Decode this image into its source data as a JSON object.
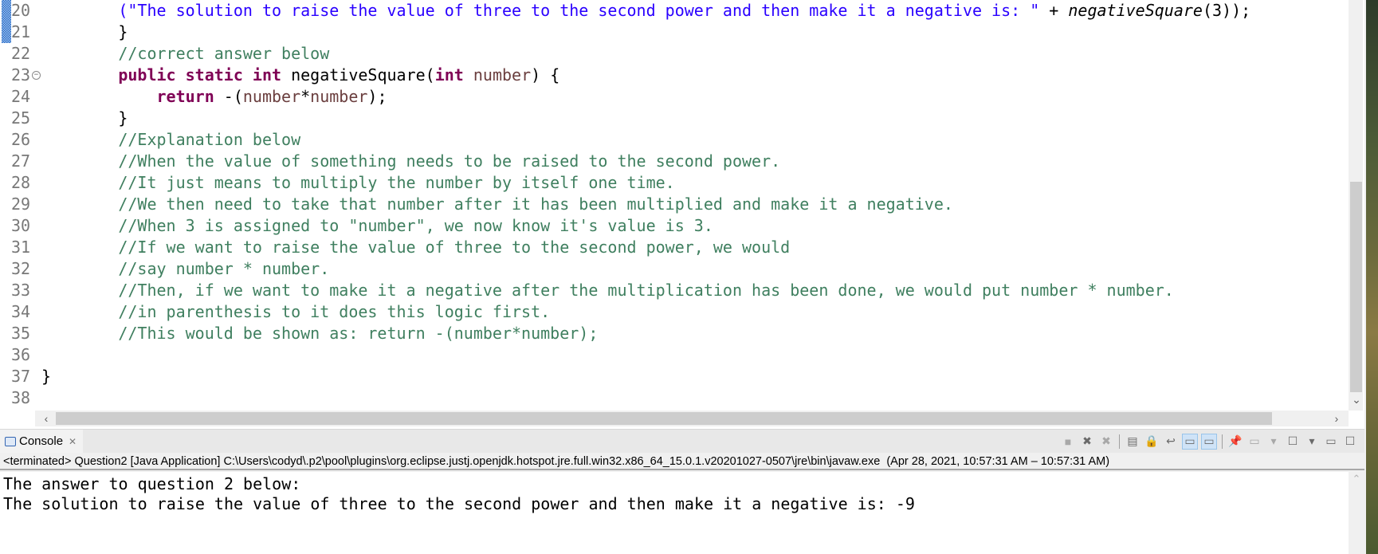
{
  "editor": {
    "lines": [
      {
        "num": "20",
        "segments": [
          {
            "cls": "pl",
            "text": "        "
          },
          {
            "cls": "str",
            "text": "(\"The solution to raise the value of three to the second power and then make it a negative is: \""
          },
          {
            "cls": "pl",
            "text": " + "
          },
          {
            "cls": "it",
            "text": "negativeSquare"
          },
          {
            "cls": "pl",
            "text": "(3));"
          }
        ]
      },
      {
        "num": "21",
        "segments": [
          {
            "cls": "pl",
            "text": "        }"
          }
        ]
      },
      {
        "num": "22",
        "segments": [
          {
            "cls": "pl",
            "text": "        "
          },
          {
            "cls": "cm",
            "text": "//correct answer below"
          }
        ]
      },
      {
        "num": "23",
        "fold": true,
        "segments": [
          {
            "cls": "pl",
            "text": "        "
          },
          {
            "cls": "kw",
            "text": "public static int"
          },
          {
            "cls": "pl",
            "text": " negativeSquare("
          },
          {
            "cls": "kw",
            "text": "int"
          },
          {
            "cls": "pl",
            "text": " "
          },
          {
            "cls": "var",
            "text": "number"
          },
          {
            "cls": "pl",
            "text": ") {"
          }
        ]
      },
      {
        "num": "24",
        "segments": [
          {
            "cls": "pl",
            "text": "            "
          },
          {
            "cls": "kw",
            "text": "return"
          },
          {
            "cls": "pl",
            "text": " -("
          },
          {
            "cls": "var",
            "text": "number"
          },
          {
            "cls": "pl",
            "text": "*"
          },
          {
            "cls": "var",
            "text": "number"
          },
          {
            "cls": "pl",
            "text": ");"
          }
        ]
      },
      {
        "num": "25",
        "segments": [
          {
            "cls": "pl",
            "text": "        }"
          }
        ]
      },
      {
        "num": "26",
        "segments": [
          {
            "cls": "pl",
            "text": "        "
          },
          {
            "cls": "cm",
            "text": "//Explanation below"
          }
        ]
      },
      {
        "num": "27",
        "segments": [
          {
            "cls": "pl",
            "text": "        "
          },
          {
            "cls": "cm",
            "text": "//When the value of something needs to be raised to the second power."
          }
        ]
      },
      {
        "num": "28",
        "segments": [
          {
            "cls": "pl",
            "text": "        "
          },
          {
            "cls": "cm",
            "text": "//It just means to multiply the number by itself one time."
          }
        ]
      },
      {
        "num": "29",
        "segments": [
          {
            "cls": "pl",
            "text": "        "
          },
          {
            "cls": "cm",
            "text": "//We then need to take that number after it has been multiplied and make it a negative."
          }
        ]
      },
      {
        "num": "30",
        "segments": [
          {
            "cls": "pl",
            "text": "        "
          },
          {
            "cls": "cm",
            "text": "//When 3 is assigned to \"number\", we now know it's value is 3."
          }
        ]
      },
      {
        "num": "31",
        "segments": [
          {
            "cls": "pl",
            "text": "        "
          },
          {
            "cls": "cm",
            "text": "//If we want to raise the value of three to the second power, we would"
          }
        ]
      },
      {
        "num": "32",
        "segments": [
          {
            "cls": "pl",
            "text": "        "
          },
          {
            "cls": "cm",
            "text": "//say number * number."
          }
        ]
      },
      {
        "num": "33",
        "segments": [
          {
            "cls": "pl",
            "text": "        "
          },
          {
            "cls": "cm",
            "text": "//Then, if we want to make it a negative after the multiplication has been done, we would put number * number."
          }
        ]
      },
      {
        "num": "34",
        "segments": [
          {
            "cls": "pl",
            "text": "        "
          },
          {
            "cls": "cm",
            "text": "//in parenthesis to it does this logic first."
          }
        ]
      },
      {
        "num": "35",
        "segments": [
          {
            "cls": "pl",
            "text": "        "
          },
          {
            "cls": "cm",
            "text": "//This would be shown as: return -(number*number);"
          }
        ]
      },
      {
        "num": "36",
        "segments": []
      },
      {
        "num": "37",
        "segments": [
          {
            "cls": "pl",
            "text": "}"
          }
        ]
      },
      {
        "num": "38",
        "segments": []
      }
    ],
    "scroll_icons": {
      "down": "chevron-down",
      "left": "chevron-left",
      "right": "chevron-right"
    }
  },
  "console": {
    "tab_label": "Console",
    "tab_icon": "console-icon",
    "tab_close_icon": "close-icon",
    "toolbar": [
      {
        "name": "terminate-icon",
        "glyph": "■",
        "state": "disabled"
      },
      {
        "name": "remove-launch-icon",
        "glyph": "✖",
        "state": "normal"
      },
      {
        "name": "remove-all-terminated-icon",
        "glyph": "✖",
        "state": "disabled"
      },
      {
        "name": "sep"
      },
      {
        "name": "clear-console-icon",
        "glyph": "▤",
        "state": "normal"
      },
      {
        "name": "scroll-lock-icon",
        "glyph": "🔒",
        "state": "normal"
      },
      {
        "name": "word-wrap-icon",
        "glyph": "↩",
        "state": "normal"
      },
      {
        "name": "show-on-stdout-icon",
        "glyph": "▭",
        "state": "active"
      },
      {
        "name": "show-on-stderr-icon",
        "glyph": "▭",
        "state": "active"
      },
      {
        "name": "sep"
      },
      {
        "name": "pin-console-icon",
        "glyph": "📌",
        "state": "normal"
      },
      {
        "name": "display-selected-console-icon",
        "glyph": "▭",
        "state": "disabled"
      },
      {
        "name": "display-dropdown-icon",
        "glyph": "▾",
        "state": "disabled"
      },
      {
        "name": "open-console-icon",
        "glyph": "☐",
        "state": "normal"
      },
      {
        "name": "open-console-dropdown-icon",
        "glyph": "▾",
        "state": "normal"
      },
      {
        "name": "minimize-icon",
        "glyph": "▭",
        "state": "normal"
      },
      {
        "name": "maximize-icon",
        "glyph": "☐",
        "state": "normal"
      }
    ],
    "path": "<terminated> Question2 [Java Application] C:\\Users\\codyd\\.p2\\pool\\plugins\\org.eclipse.justj.openjdk.hotspot.jre.full.win32.x86_64_15.0.1.v20201027-0507\\jre\\bin\\javaw.exe  (Apr 28, 2021, 10:57:31 AM – 10:57:31 AM)",
    "output": [
      "The answer to question 2 below:",
      "The solution to raise the value of three to the second power and then make it a negative is: -9"
    ]
  }
}
